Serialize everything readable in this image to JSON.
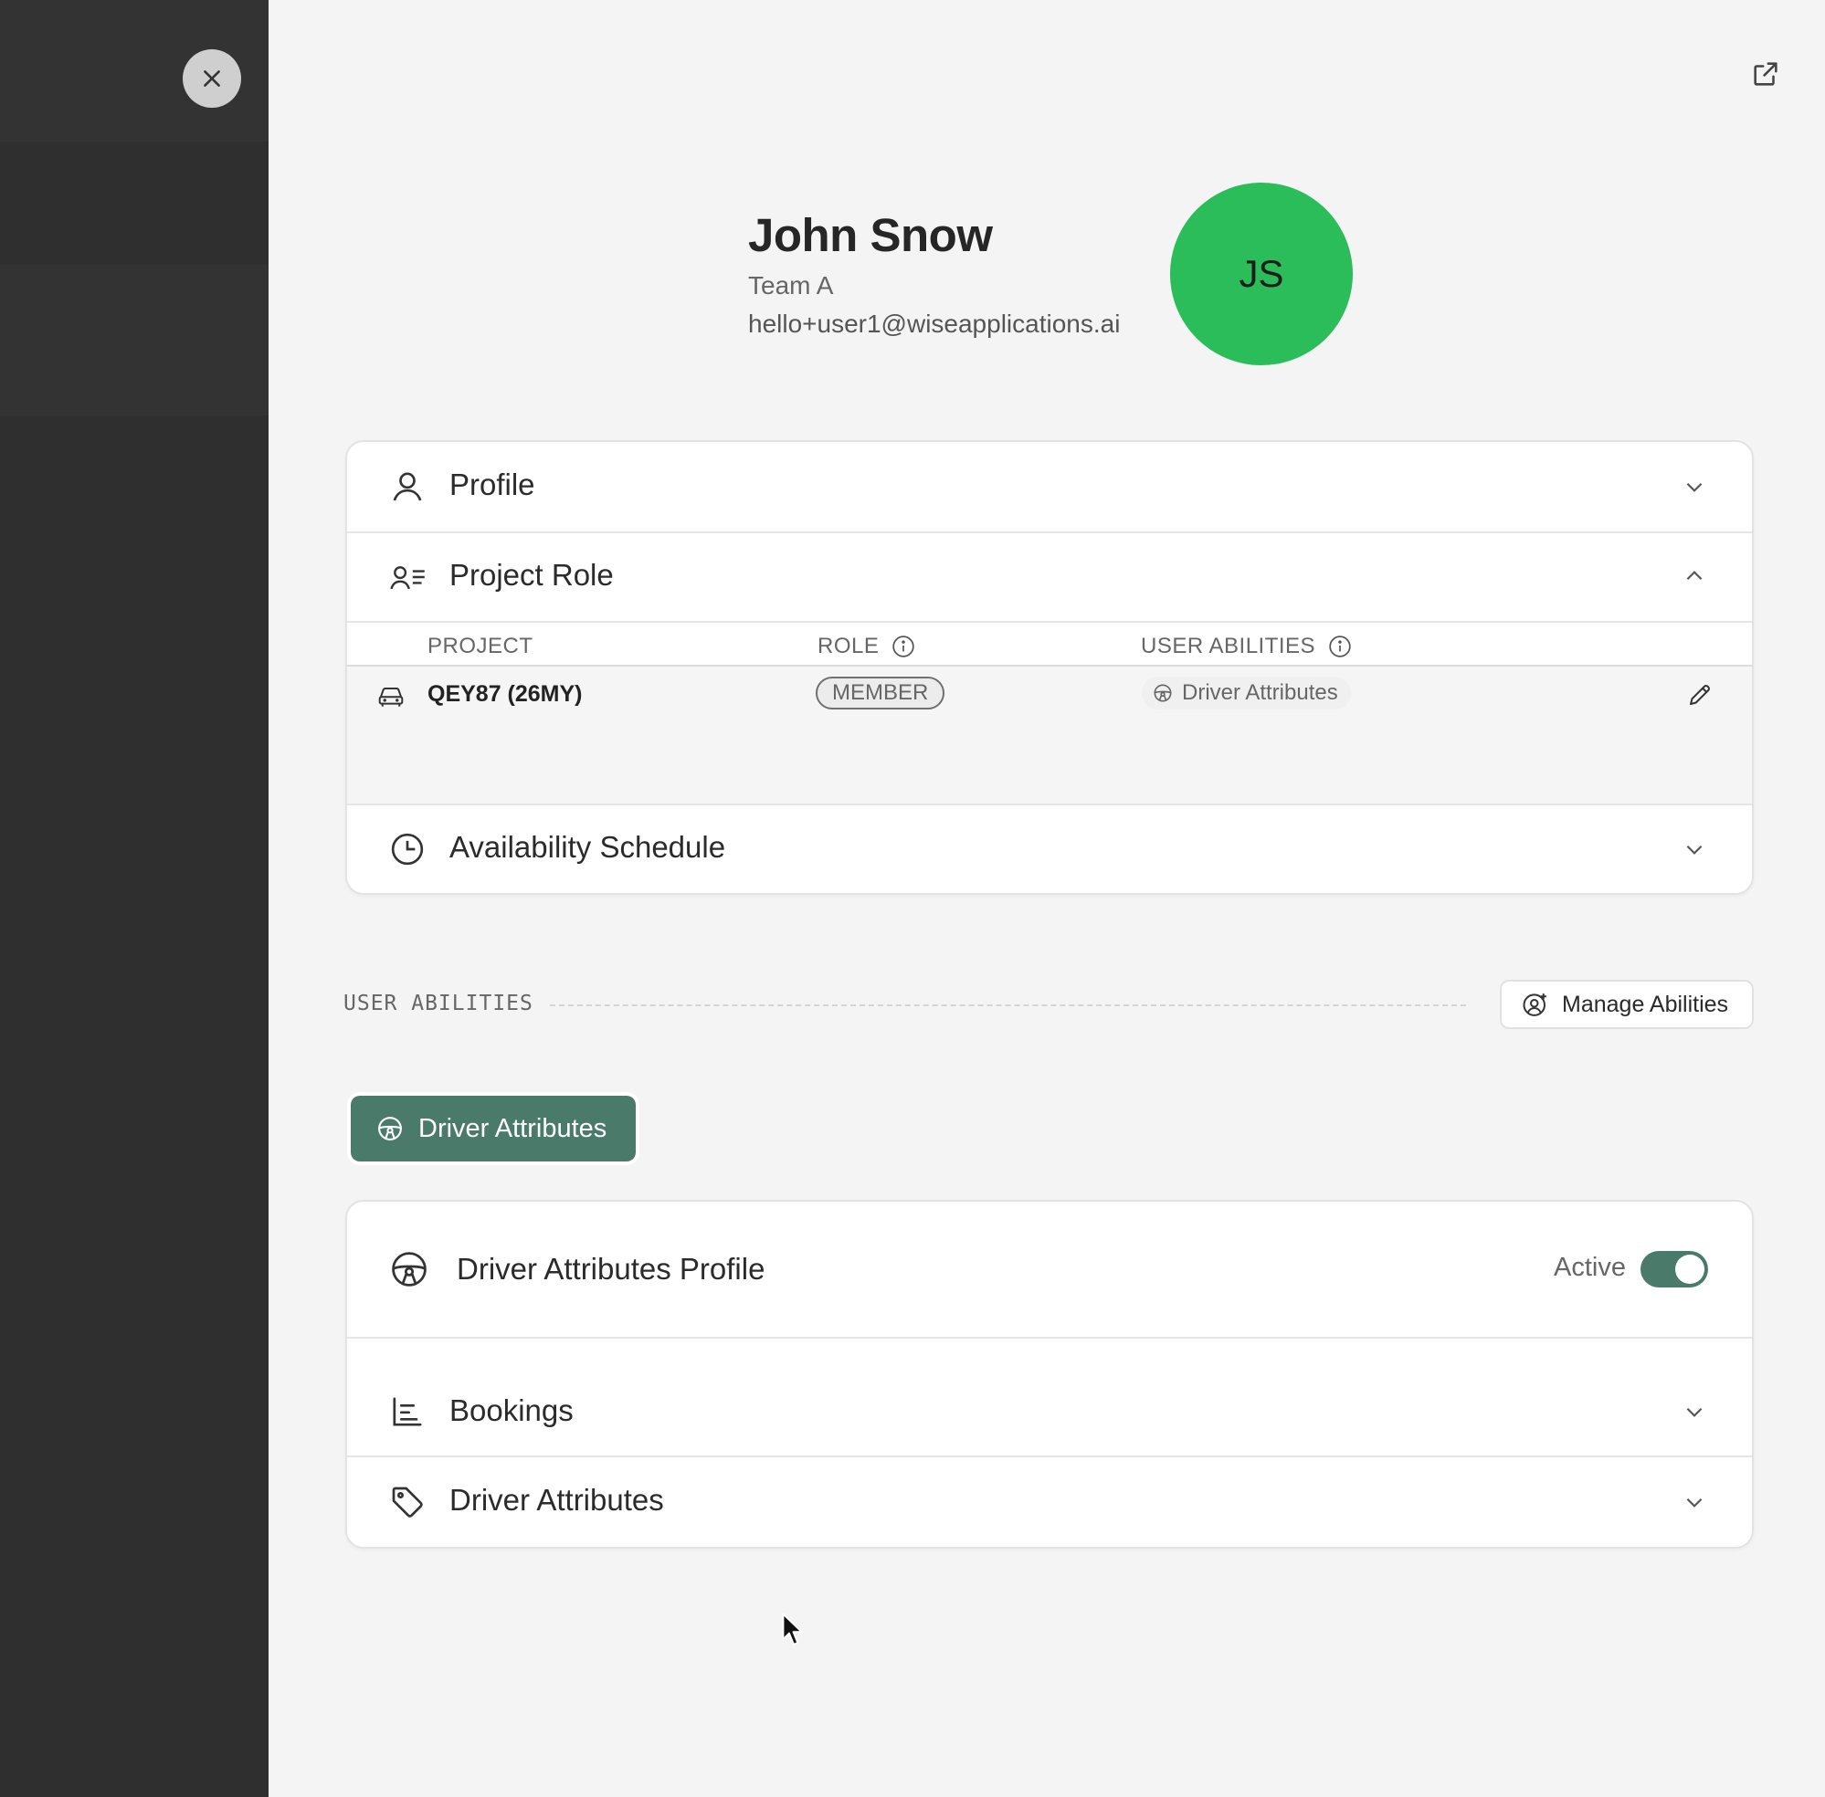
{
  "user": {
    "name": "John Snow",
    "team": "Team A",
    "email": "hello+user1@wiseapplications.ai",
    "initials": "JS",
    "avatar_color": "#2bbd5a"
  },
  "sections": {
    "profile": "Profile",
    "project_role": "Project Role",
    "availability": "Availability Schedule"
  },
  "project_table": {
    "headers": {
      "project": "PROJECT",
      "role": "ROLE",
      "abilities": "USER ABILITIES"
    },
    "rows": [
      {
        "project": "QEY87 (26MY)",
        "role": "MEMBER",
        "ability": "Driver Attributes"
      }
    ]
  },
  "user_abilities": {
    "section_label": "USER ABILITIES",
    "manage_button": "Manage Abilities",
    "active_tab": "Driver Attributes",
    "profile_title": "Driver Attributes Profile",
    "status_label": "Active",
    "status_on": true,
    "sub_sections": {
      "bookings": "Bookings",
      "driver_attributes": "Driver Attributes"
    }
  },
  "colors": {
    "accent": "#4a7a6a",
    "backdrop": "#2f2f2f",
    "panel": "#f4f4f4"
  },
  "icons": {
    "close": "close-icon",
    "open_external": "external-link-icon",
    "profile": "user-icon",
    "project_role": "user-list-icon",
    "availability": "clock-icon",
    "car": "car-icon",
    "steering_wheel": "steering-wheel-icon",
    "bookings": "bar-list-icon",
    "tag": "tag-icon",
    "edit": "pencil-icon",
    "info": "info-icon",
    "chevron": "chevron-icon",
    "manage": "user-settings-icon"
  }
}
